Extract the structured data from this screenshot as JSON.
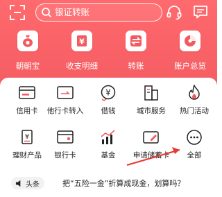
{
  "header": {
    "search_placeholder": "银证转账",
    "brand_color": "#f25a60"
  },
  "quick_actions": [
    {
      "icon": "money-bag-icon",
      "label": "朝朝宝"
    },
    {
      "icon": "yen-receipt-icon",
      "label": "收支明细"
    },
    {
      "icon": "transfer-arrows-icon",
      "label": "转账"
    },
    {
      "icon": "pie-chart-icon",
      "label": "账户总览"
    }
  ],
  "services": [
    {
      "icon": "credit-card-icon",
      "label": "信用卡"
    },
    {
      "icon": "card-transfer-in-icon",
      "label": "他行卡转入"
    },
    {
      "icon": "yen-coin-icon",
      "label": "借钱"
    },
    {
      "icon": "city-buildings-icon",
      "label": "城市服务"
    },
    {
      "icon": "flame-icon",
      "label": "热门活动"
    },
    {
      "icon": "yen-document-icon",
      "label": "理财产品"
    },
    {
      "icon": "bank-card-icon",
      "label": "银行卡"
    },
    {
      "icon": "fund-growth-icon",
      "label": "基金"
    },
    {
      "icon": "apply-card-icon",
      "label": "申请储蓄卡"
    },
    {
      "icon": "more-dots-icon",
      "label": "全部"
    }
  ],
  "news": {
    "tag": "头条",
    "headline": "把“五险一金”折算成现金，划算吗？"
  }
}
